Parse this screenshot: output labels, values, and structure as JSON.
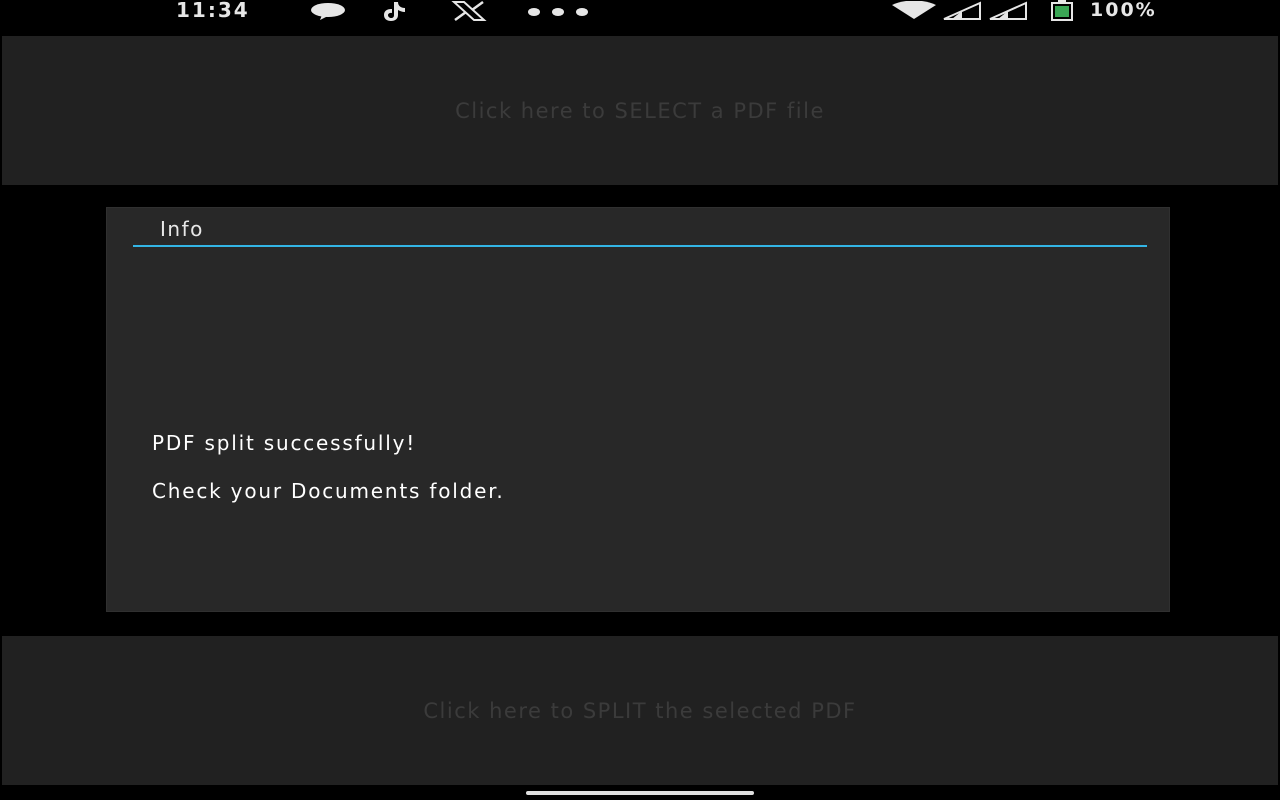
{
  "status_bar": {
    "time": "11:34",
    "battery_text": "100%",
    "icons": [
      "chat-bubble-icon",
      "tiktok-icon",
      "x-logo-icon",
      "more-dots-icon",
      "wifi-icon",
      "cell-signal-icon",
      "cell-signal-icon",
      "battery-icon"
    ]
  },
  "select_button": {
    "label": "Click here to SELECT a PDF file"
  },
  "dialog": {
    "title": "Info",
    "message_line1": "PDF split successfully!",
    "message_line2": "Check your Documents folder.",
    "accent_color": "#33b5e5"
  },
  "split_button": {
    "label": "Click here to SPLIT the selected PDF"
  }
}
